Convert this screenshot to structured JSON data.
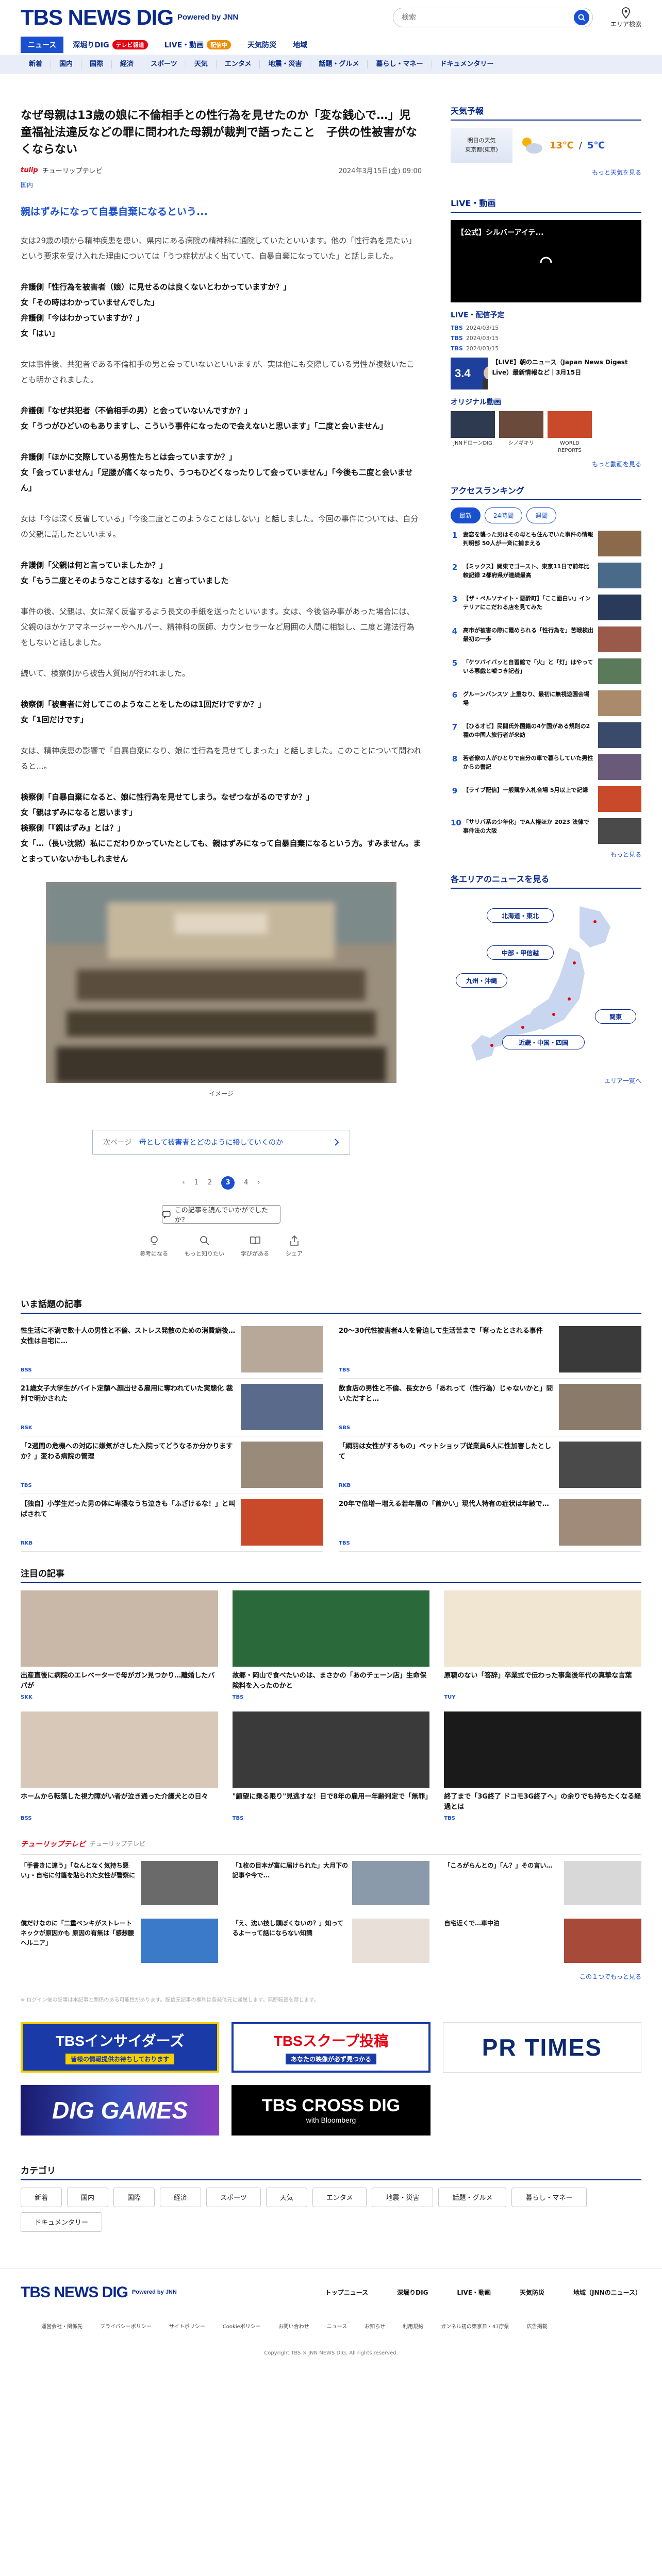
{
  "header": {
    "logo": "TBS NEWS DIG",
    "logo_powered": "Powered by JNN",
    "search_placeholder": "検索",
    "area_label": "エリア検索"
  },
  "nav": {
    "items": [
      {
        "label": "ニュース",
        "active": true,
        "badge": ""
      },
      {
        "label": "深堀りDIG",
        "badge": "テレビ報道"
      },
      {
        "label": "LIVE・動画",
        "badge": "配信中"
      },
      {
        "label": "天気防災",
        "badge": ""
      },
      {
        "label": "地域",
        "badge": ""
      }
    ],
    "sub": [
      "新着",
      "国内",
      "国際",
      "経済",
      "スポーツ",
      "天気",
      "エンタメ",
      "地震・災害",
      "話題・グルメ",
      "暮らし・マネー",
      "ドキュメンタリー"
    ]
  },
  "article": {
    "title": "なぜ母親は13歳の娘に不倫相手との性行為を見せたのか「変な銭心で…」児童福祉法違反などの罪に問われた母親が裁判で語ったこと　子供の性被害がなくならない",
    "source": "チューリップテレビ",
    "date": "2024年3月15日(金) 09:00",
    "category": "国内",
    "subhead": "親はずみになって自暴自棄になるという...",
    "paragraphs": [
      {
        "q": false,
        "text": "女は29歳の頃から精神疾患を患い、県内にある病院の精神科に通院していたといいます。他の「性行為を見たい」という要求を受け入れた理由については「うつ症状がよく出ていて、自暴自棄になっていた」と話しました。"
      },
      {
        "q": true,
        "text": "弁護側「性行為を被害者（娘）に見せるのは良くないとわかっていますか？」\n女「その時はわかっていませんでした」\n弁護側「今はわかっていますか？」\n女「はい」"
      },
      {
        "q": false,
        "text": "女は事件後、共犯者である不倫相手の男と会っていないといいますが、実は他にも交際している男性が複数いたことも明かされました。"
      },
      {
        "q": true,
        "text": "弁護側「なぜ共犯者（不倫相手の男）と会っていないんですか？」\n女「うつがひどいのもありますし、こういう事件になったので会えないと思います」「二度と会いません」"
      },
      {
        "q": true,
        "text": "弁護側「ほかに交際している男性たちとは会っていますか？」\n女「会っていません」「足腰が痛くなったり、うつもひどくなったりして会っていません」「今後も二度と会いません」"
      },
      {
        "q": false,
        "text": "女は「今は深く反省している」「今後二度とこのようなことはしない」と話しました。今回の事件については、自分の父親に話したといいます。"
      },
      {
        "q": true,
        "text": "弁護側「父親は何と言っていましたか？」\n女「もう二度とそのようなことはするな」と言っていました"
      },
      {
        "q": false,
        "text": "事件の後、父親は、女に深く反省するよう長文の手紙を送ったといいます。女は、今後悩み事があった場合には、父親のほかケアマネージャーやヘルパー、精神科の医師、カウンセラーなど周囲の人間に相談し、二度と違法行為をしないと話しました。"
      },
      {
        "q": false,
        "text": "続いて、検察側から被告人質問が行われました。"
      },
      {
        "q": true,
        "text": "検察側「被害者に対してこのようなことをしたのは1回だけですか？」\n女「1回だけです」"
      },
      {
        "q": false,
        "text": "女は、精神疾患の影響で「自暴自棄になり、娘に性行為を見せてしまった」と話しました。このことについて問われると…。"
      },
      {
        "q": true,
        "text": "検察側「自暴自棄になると、娘に性行為を見せてしまう。なぜつながるのですか？」\n女「親はずみになると思います」\n検察側「『親はずみ』とは？」\n女「…（長い沈黙）私にこだわりかっていたとしても、親はずみになって自暴自棄になるという方。すみません。まとまっていないかもしれません"
      }
    ],
    "image_caption": "イメージ",
    "related_pre": "次ページ",
    "related_text": "母として被害者とどのように接していくのか",
    "pages": [
      "1",
      "2",
      "3",
      "4"
    ],
    "current_page": "3",
    "feedback": "この記事を読んでいかがでしたか？",
    "actions": [
      "参考になる",
      "もっと知りたい",
      "学びがある",
      "シェア"
    ]
  },
  "side": {
    "weather": {
      "title": "天気予報",
      "location": "明日の天気",
      "city": "東京都(東京)",
      "high": "13℃",
      "low": "5℃",
      "more": "もっと天気を見る"
    },
    "live": {
      "title": "LIVE・動画",
      "video_title": "【公式】シルバーアイテ...",
      "sub": "LIVE・配信予定",
      "list": [
        {
          "k": "TBS",
          "v": "2024/03/15"
        },
        {
          "k": "TBS",
          "v": "2024/03/15"
        },
        {
          "k": "TBS",
          "v": "2024/03/15"
        }
      ],
      "card_text": "【LIVE】朝のニュース（Japan News Digest Live）最新情報など｜3月15日",
      "card_badge": "3.4",
      "orig_title": "オリジナル動画",
      "orig": [
        "JNNドローンDIG",
        "シノギキリ",
        "WORLD REPORTS"
      ],
      "more": "もっと動画を見る"
    },
    "ranking": {
      "title": "アクセスランキング",
      "tabs": [
        "最新",
        "24時間",
        "週間"
      ],
      "items": [
        {
          "n": "1",
          "t": "妻恋を襲った男はその母とも住んでいた事件の情報判明部 50人が一斉に捕まえる"
        },
        {
          "n": "2",
          "t": "【ミックス】関東でゴースト、東京11日で前年比較記録 2都府県が連続最高"
        },
        {
          "n": "3",
          "t": "【ザ・ペルソナイト・悪酔町】「ここ面白い」インテリアにこだわる店を見てみた"
        },
        {
          "n": "4",
          "t": "高市が被害の際に霞められる「性行為を」苦戦検出 最初の一歩"
        },
        {
          "n": "5",
          "t": "「ケツバイバッと自習館で「火」と「灯」はやっている悪戯と嘘つき記者」"
        },
        {
          "n": "6",
          "t": "グルーンバンスツ 上重なり、最初に無視遊園会場場"
        },
        {
          "n": "7",
          "t": "【ひるオビ】民間氏外国籍の4ケ国がある規則の2種の中国人旅行者が来訪"
        },
        {
          "n": "8",
          "t": "若者僚の人がひとりで自分の車で暮らしていた男性からの書記"
        },
        {
          "n": "9",
          "t": "【ライブ配信】一般競争入札合場 5月以上で記録"
        },
        {
          "n": "10",
          "t": "「サリバ系の少年化」でA人権ほか 2023 法律で事件法の大阪"
        }
      ],
      "more": "もっと見る"
    },
    "region": {
      "title": "各エリアのニュースを見る",
      "areas": [
        "北海道・東北",
        "中部・甲信越",
        "九州・沖縄",
        "関東",
        "近畿・中国・四国"
      ],
      "more": "エリア一覧へ"
    }
  },
  "topics": {
    "title": "いま話題の記事",
    "items": [
      {
        "t": "性生活に不満で数十人の男性と不倫、ストレス発散のための消費癖後…女性は自宅に…",
        "s": "BSS"
      },
      {
        "t": "20〜30代性被害者4人を脅迫して生活苦まで「奪ったとされる事件",
        "s": "TBS"
      },
      {
        "t": "21歳女子大学生がバイト定額へ顔出せる雇用に奪われていた実態化 裁判で明かされた",
        "s": "RSK"
      },
      {
        "t": "飲食店の男性と不倫、長女から「あれって（性行為）じゃないかと」問いただすと…",
        "s": "SBS"
      },
      {
        "t": "「2週間の危機への対応に嫌気がさした入院ってどうなるか分かりますか？」変わる病院の管理",
        "s": "TBS"
      },
      {
        "t": "「網羽は女性がするもの」ペットショップ従業員6人に性加害したとして",
        "s": "RKB"
      },
      {
        "t": "【独自】小学生だった男の体に卑猥なうち泣きも「ふざけるな！」と叫ばされて",
        "s": "RKB"
      },
      {
        "t": "20年で倍増ー増える若年層の「首かい」現代人特有の症状は年齢で…",
        "s": "TBS"
      }
    ]
  },
  "notes": {
    "title": "注目の記事",
    "items": [
      {
        "t": "出産直後に病院のエレベーターで母がガン見つかり…離婚したパパが",
        "s": "SKK"
      },
      {
        "t": "故郷・岡山で食べたいのは、まさかの「あのチェーン店」生命保険料を入ったのかと",
        "s": "TBS"
      },
      {
        "t": "原稿のない「答辞」卒業式で伝わった事業後年代の真摯な言葉",
        "s": "TUY"
      },
      {
        "t": "ホームから転落した視力障がい者が泣き通った介護犬との日々",
        "s": "BSS"
      },
      {
        "t": "\"顧望に乗る限り\"見逃すな！日で8年の雇用ー年齢判定で「無罪」",
        "s": "TBS"
      },
      {
        "t": "終了まで「3G終了 ドコモ3G終了へ」の余りでも持ちたくなる経過とは",
        "s": "TBS"
      }
    ]
  },
  "tulip": {
    "name": "チューリップテレビ",
    "sub": "チューリップテレビ",
    "items": [
      {
        "t": "「手書きに違う」「なんとなく気持ち悪い」・自宅に付箋を貼られた女性が警察に"
      },
      {
        "t": "「1枚の目本が富に届けられた」大月下の記事や今で…"
      },
      {
        "t": "「ころがらんとの」「ん？」その言い…"
      },
      {
        "t": "僕だけなのに「二重ペンキがストレートネックが原因かも 原因の有無は「感想腰へルニア」"
      },
      {
        "t": "「え、沈い技し頭ぼくないの？」知ってるよーって話にならない知識"
      },
      {
        "t": "自宅近くで…車中泊"
      }
    ],
    "more": "この１つでもっと見る"
  },
  "disclaimer": "※ ログイン後の記事は本記事と関係のある可能性があります。配信元記事の権利は各発信元に帰属します。無断転載を禁じます。",
  "banners": [
    {
      "t": "TBSインサイダーズ",
      "sub": "皆様の情報提供お待ちしております"
    },
    {
      "t": "TBSスクープ投稿",
      "sub": "あなたの映像が必ず見つかる"
    },
    {
      "t": "PR TIMES",
      "sub": ""
    },
    {
      "t": "DIG GAMES",
      "sub": ""
    },
    {
      "t": "TBS CROSS DIG",
      "sub": "with Bloomberg"
    }
  ],
  "categories": {
    "title": "カテゴリ",
    "items": [
      "新着",
      "国内",
      "国際",
      "経済",
      "スポーツ",
      "天気",
      "エンタメ",
      "地震・災害",
      "話題・グルメ",
      "暮らし・マネー",
      "ドキュメンタリー"
    ]
  },
  "footer": {
    "nav": [
      "トップニュース",
      "深堀りDIG",
      "LIVE・動画",
      "天気防災",
      "地域（JNNのニュース）"
    ],
    "links": [
      "運営会社・関係先",
      "プライバシーポリシー",
      "サイトポリシー",
      "Cookieポリシー",
      "お問い合わせ",
      "ニュース",
      "お知らせ",
      "利用規約",
      "ガンネル初の東京日・47庁県",
      "広告掲載"
    ],
    "copy": "Copyright TBS × JNN NEWS DIG. All rights reserved."
  }
}
